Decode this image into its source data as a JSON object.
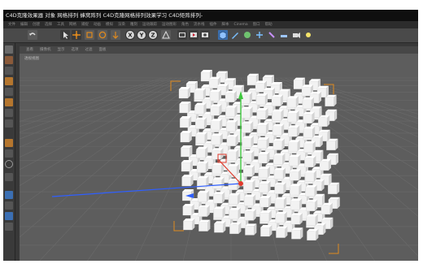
{
  "window": {
    "title": "C4D克隆效果器 对象 网格排列 蜂窝阵列   C4D克隆网格排列效果学习 C4D矩阵排列-"
  },
  "menubar": {
    "items": [
      "文件",
      "编辑",
      "创建",
      "选择",
      "工具",
      "网格",
      "捕捉",
      "动画",
      "模拟",
      "渲染",
      "雕刻",
      "运动跟踪",
      "运动图形",
      "角色",
      "流水线",
      "插件",
      "脚本",
      "Cinema",
      "窗口",
      "帮助"
    ]
  },
  "toolbar": {
    "axis_labels": [
      "X",
      "Y",
      "Z"
    ]
  },
  "viewport": {
    "menu": [
      "查看",
      "摄像机",
      "显示",
      "选项",
      "过滤",
      "面板"
    ],
    "label": "透视视图"
  },
  "colors": {
    "accent_orange": "#e08a1e",
    "axis_y": "#3ec83e",
    "axis_x": "#e03a2c",
    "axis_z": "#2f5fff",
    "cube": "#f2f2f2",
    "grid": "#6b6b6b",
    "viewport_bg": "#5d5d5d"
  },
  "icons": [
    "undo-icon",
    "select-arrow-icon",
    "move-icon",
    "scale-icon",
    "rotate-icon",
    "x-axis-icon",
    "y-axis-icon",
    "z-axis-icon",
    "world-icon",
    "render-icon",
    "cube-primitive-icon",
    "pen-icon",
    "subdivision-icon",
    "array-icon",
    "deformer-icon",
    "floor-icon",
    "camera-icon",
    "light-icon"
  ]
}
